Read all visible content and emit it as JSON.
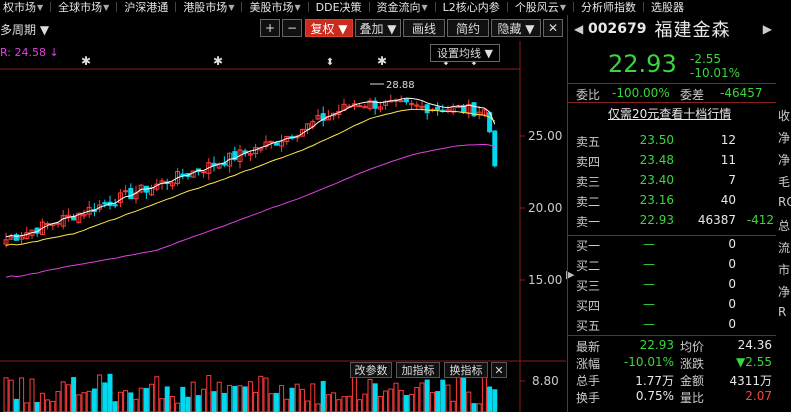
{
  "nav": [
    {
      "label": "权市场",
      "arrow": true
    },
    {
      "label": "全球市场",
      "arrow": true
    },
    {
      "label": "沪深港通",
      "arrow": false
    },
    {
      "label": "港股市场",
      "arrow": true
    },
    {
      "label": "美股市场",
      "arrow": true
    },
    {
      "label": "DDE决策",
      "arrow": false
    },
    {
      "label": "资金流向",
      "arrow": true
    },
    {
      "label": "L2核心内参",
      "arrow": false
    },
    {
      "label": "个股风云",
      "arrow": true
    },
    {
      "label": "分析师指数",
      "arrow": false
    },
    {
      "label": "选股器",
      "arrow": false
    }
  ],
  "toolbar": {
    "period": "多周期 ▼",
    "plus": "+",
    "minus": "−",
    "fuquan": "复权 ▼",
    "diejia": "叠加 ▼",
    "xianxian": "画线",
    "jianyue": "简约",
    "yincang": "隐藏 ▼",
    "close_glyph": "✕"
  },
  "chart_labels": {
    "ma_label": "R: 24.58 ↓",
    "ma_settings": "设置均线 ▼",
    "annotation_price": "28.88",
    "yticks": [
      "25.00",
      "20.00",
      "15.00",
      "8.80"
    ],
    "indicator_buttons": [
      "改参数",
      "加指标",
      "换指标"
    ]
  },
  "stock": {
    "code": "002679",
    "name": "福建金森",
    "price": "22.93",
    "change": "-2.55",
    "change_pct": "-10.01%",
    "weibi_label": "委比",
    "weibi": "-100.00%",
    "weicha_label": "委差",
    "weicha": "-46457",
    "level10_link": "仅需20元查看十档行情"
  },
  "asks": [
    {
      "label": "卖五",
      "price": "23.50",
      "vol": "12",
      "extra": ""
    },
    {
      "label": "卖四",
      "price": "23.48",
      "vol": "11",
      "extra": ""
    },
    {
      "label": "卖三",
      "price": "23.40",
      "vol": "7",
      "extra": ""
    },
    {
      "label": "卖二",
      "price": "23.16",
      "vol": "40",
      "extra": ""
    },
    {
      "label": "卖一",
      "price": "22.93",
      "vol": "46387",
      "extra": "-412"
    }
  ],
  "bids": [
    {
      "label": "买一",
      "price": "—",
      "vol": "0"
    },
    {
      "label": "买二",
      "price": "—",
      "vol": "0"
    },
    {
      "label": "买三",
      "price": "—",
      "vol": "0"
    },
    {
      "label": "买四",
      "price": "—",
      "vol": "0"
    },
    {
      "label": "买五",
      "price": "—",
      "vol": "0"
    }
  ],
  "quote": [
    {
      "l1": "最新",
      "v1": "22.93",
      "l2": "均价",
      "v2": "24.36"
    },
    {
      "l1": "涨幅",
      "v1": "-10.01%",
      "l2": "涨跌",
      "v2": "▼2.55"
    },
    {
      "l1": "总手",
      "v1": "1.77万",
      "l2": "金额",
      "v2": "4311万"
    },
    {
      "l1": "换手",
      "v1": "0.75%",
      "l2": "量比",
      "v2": "2.07"
    }
  ],
  "side_labels": [
    "收",
    "净",
    "净",
    "毛",
    "RO",
    "总",
    "流",
    "市",
    "净",
    "R"
  ],
  "colors": {
    "up": "#ff3b3b",
    "down": "#00d8f0",
    "ma5": "#ffffff",
    "ma10": "#ffe84a",
    "ma20": "#e040e0",
    "border": "#8b1e1e"
  }
}
